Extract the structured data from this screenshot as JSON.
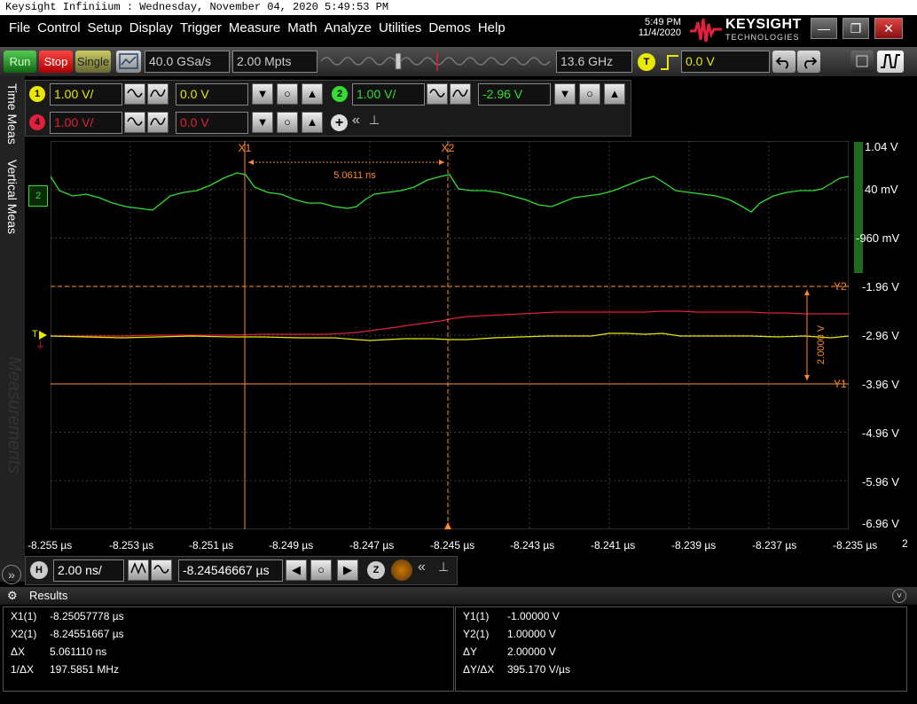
{
  "title_bar": "Keysight Infiniium : Wednesday, November 04, 2020 5:49:53 PM",
  "menu": [
    "File",
    "Control",
    "Setup",
    "Display",
    "Trigger",
    "Measure",
    "Math",
    "Analyze",
    "Utilities",
    "Demos",
    "Help"
  ],
  "clock": {
    "time": "5:49 PM",
    "date": "11/4/2020"
  },
  "brand": {
    "name": "KEYSIGHT",
    "sub": "TECHNOLOGIES"
  },
  "window_buttons": {
    "minimize": "—",
    "restore": "❐",
    "close": "✕"
  },
  "toolbar": {
    "run": "Run",
    "stop": "Stop",
    "single": "Single",
    "sample_rate": "40.0 GSa/s",
    "memory_depth": "2.00 Mpts",
    "bandwidth": "13.6 GHz",
    "trigger_badge": "T",
    "trigger_level": "0.0 V"
  },
  "channels": {
    "ch1": {
      "num": "1",
      "scale": "1.00 V/",
      "offset": "0.0 V",
      "color": "#e8e800"
    },
    "ch2": {
      "num": "2",
      "scale": "1.00 V/",
      "offset": "-2.96 V",
      "color": "#33dd33"
    },
    "ch4": {
      "num": "4",
      "scale": "1.00 V/",
      "offset": "0.0 V",
      "color": "#e0203c"
    }
  },
  "side_tabs": [
    "Time Meas",
    "Vertical Meas",
    "Measurements"
  ],
  "grid": {
    "x_ticks": [
      "-8.255 µs",
      "-8.253 µs",
      "-8.251 µs",
      "-8.249 µs",
      "-8.247 µs",
      "-8.245 µs",
      "-8.243 µs",
      "-8.241 µs",
      "-8.239 µs",
      "-8.237 µs",
      "-8.235 µs"
    ],
    "y_ticks": [
      "1.04 V",
      "40 mV",
      "-960 mV",
      "-1.96 V",
      "-2.96 V",
      "-3.96 V",
      "-4.96 V",
      "-5.96 V",
      "-6.96 V"
    ],
    "x1_label": "X1",
    "x2_label": "X2",
    "y1_label": "Y1",
    "y2_label": "Y2",
    "delta_x": "5.0611 ns",
    "delta_y": "2.0000 V",
    "trigger_marker": "T",
    "right_edge": "2"
  },
  "horizontal": {
    "badge": "H",
    "scale": "2.00 ns/",
    "position": "-8.24546667 µs",
    "zoom_badge": "Z"
  },
  "results": {
    "header": "Results",
    "left": [
      {
        "label": "X1(1)",
        "value": "-8.25057778 µs"
      },
      {
        "label": "X2(1)",
        "value": "-8.24551667 µs"
      },
      {
        "label": "ΔX",
        "value": "5.061110 ns"
      },
      {
        "label": "1/ΔX",
        "value": "197.5851 MHz"
      }
    ],
    "right": [
      {
        "label": "Y1(1)",
        "value": "-1.00000 V"
      },
      {
        "label": "Y2(1)",
        "value": "1.00000 V"
      },
      {
        "label": "ΔY",
        "value": "2.00000 V"
      },
      {
        "label": "ΔY/ΔX",
        "value": "395.170 V/µs"
      }
    ]
  }
}
